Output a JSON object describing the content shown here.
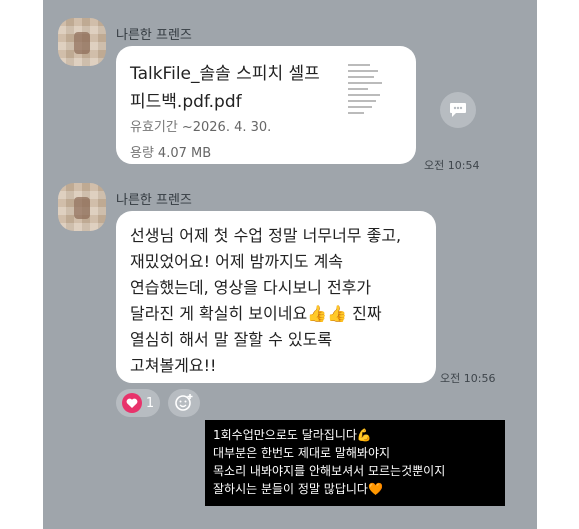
{
  "messages": [
    {
      "sender": "나른한 프렌즈",
      "file": {
        "name": "TalkFile_솔솔 스피치 셀프 피드백.pdf.pdf",
        "expiry_label": "유효기간",
        "expiry_value": "~2026. 4. 30.",
        "size_label": "용량",
        "size_value": "4.07 MB"
      },
      "time": "오전 10:54",
      "icons": {
        "share": "share-icon",
        "thumbnail": "pdf-thumbnail"
      }
    },
    {
      "sender": "나른한 프렌즈",
      "text": "선생님 어제 첫 수업 정말 너무너무 좋고,\n재밌었어요! 어제 밤까지도 계속\n연습했는데, 영상을 다시보니 전후가\n달라진 게 확실히 보이네요👍👍 진짜\n열심히 해서 말 잘할 수 있도록\n고쳐볼게요!!",
      "time": "오전 10:56",
      "reactions": {
        "heart_count": "1",
        "heart_icon": "heart-icon",
        "add_icon": "add-reaction-icon"
      }
    }
  ],
  "caption": "1회수업만으로도 달라집니다💪\n대부분은 한번도 제대로 말해봐야지\n목소리 내봐야지를 안해보셔서 모르는것뿐이지\n잘하시는 분들이 정말 많답니다🧡",
  "colors": {
    "chat_bg": "#9fa5ab",
    "bubble": "#ffffff",
    "heart": "#e8336b",
    "caption_bg": "#000000"
  }
}
